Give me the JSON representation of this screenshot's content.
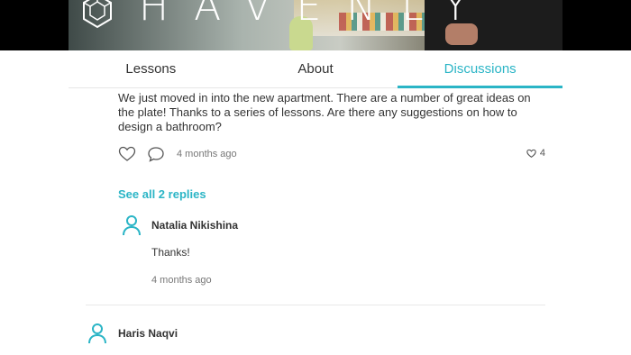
{
  "hero": {
    "brand": "HAVENLY"
  },
  "tabs": [
    {
      "label": "Lessons",
      "active": false
    },
    {
      "label": "About",
      "active": false
    },
    {
      "label": "Discussions",
      "active": true
    }
  ],
  "comment": {
    "text": "We just moved in into the new apartment. There are a number of great ideas on the plate! Thanks to a series of lessons. Are there any suggestions on how to design a bathroom?",
    "time": "4 months ago",
    "like_count": "4",
    "see_replies_label": "See all 2 replies"
  },
  "reply": {
    "author": "Natalia Nikishina",
    "text": "Thanks!",
    "time": "4 months ago"
  },
  "next_comment": {
    "author": "Haris Naqvi"
  },
  "colors": {
    "accent": "#2bb5c6",
    "text": "#333333",
    "muted": "#777777"
  }
}
